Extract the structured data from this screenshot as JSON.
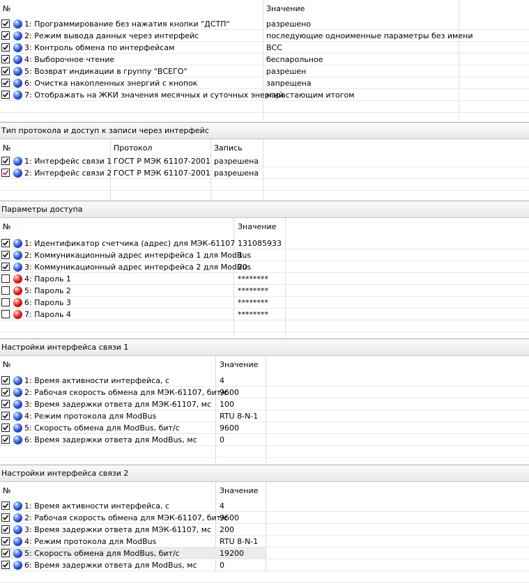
{
  "section1": {
    "header": {
      "num": "№",
      "value": "Значение"
    },
    "rows": [
      {
        "checked": true,
        "ball": "blue",
        "label": "1: Программирование без нажатия кнопки \"ДСТП\"",
        "value": "разрешено"
      },
      {
        "checked": true,
        "ball": "blue",
        "label": "2: Режим вывода данных через интерфейс",
        "value": "последующие одноименные параметры без имени"
      },
      {
        "checked": true,
        "ball": "blue",
        "label": "3: Контроль обмена по интерфейсам",
        "value": "ВСС"
      },
      {
        "checked": true,
        "ball": "blue",
        "label": "4: Выборочное чтение",
        "value": "беспарольное"
      },
      {
        "checked": true,
        "ball": "blue",
        "label": "5: Возврат индикации в  группу \"ВСЕГО\"",
        "value": "разрешен"
      },
      {
        "checked": true,
        "ball": "blue",
        "label": "6: Очистка накопленных энергий с кнопок",
        "value": "запрещена"
      },
      {
        "checked": true,
        "ball": "blue",
        "label": "7: Отображать на ЖКИ значения месячных и суточных энергий",
        "value": "нарастающим итогом"
      }
    ]
  },
  "section2": {
    "title": "Тип протокола и доступ к записи через интерфейс",
    "header": {
      "num": "№",
      "protocol": "Протокол",
      "write": "Запись"
    },
    "rows": [
      {
        "checked": true,
        "ball": "blue",
        "label": "1: Интерфейс связи 1",
        "protocol": "ГОСТ Р МЭК 61107-2001",
        "write": "разрешена"
      },
      {
        "checked": true,
        "check_red": true,
        "ball": "blue",
        "label": "2: Интерфейс связи 2",
        "protocol": "ГОСТ Р МЭК 61107-2001",
        "write": "разрешена"
      }
    ]
  },
  "section3": {
    "title": "Параметры доступа",
    "header": {
      "num": "№",
      "value": "Значение"
    },
    "rows": [
      {
        "checked": true,
        "ball": "blue",
        "label": "1: Идентификатор счетчика (адрес) для МЭК-61107",
        "value": "131085933"
      },
      {
        "checked": true,
        "ball": "blue",
        "label": "2: Коммуникационный адрес интерфейса 1 для ModBus",
        "value": "1"
      },
      {
        "checked": true,
        "ball": "blue",
        "label": "3: Коммуникационный адрес интерфейса 2 для ModBus",
        "value": "20"
      },
      {
        "checked": false,
        "ball": "red",
        "label": "4: Пароль 1",
        "value": "********"
      },
      {
        "checked": false,
        "ball": "red",
        "label": "5: Пароль 2",
        "value": "********"
      },
      {
        "checked": false,
        "ball": "red",
        "label": "6: Пароль 3",
        "value": "********"
      },
      {
        "checked": false,
        "ball": "red",
        "label": "7: Пароль 4",
        "value": "********"
      }
    ]
  },
  "section4": {
    "title": "Настройки интерфейса связи 1",
    "header": {
      "num": "№",
      "value": "Значение"
    },
    "rows": [
      {
        "checked": true,
        "ball": "blue",
        "label": "1: Время активности интерфейса, с",
        "value": "4"
      },
      {
        "checked": true,
        "ball": "blue",
        "label": "2: Рабочая скорость обмена для МЭК-61107, бит/с",
        "value": "9600"
      },
      {
        "checked": true,
        "ball": "blue",
        "label": "3: Время задержки ответа для МЭК-61107, мс",
        "value": "100"
      },
      {
        "checked": true,
        "ball": "blue",
        "label": "4: Режим протокола для ModBus",
        "value": "RTU 8-N-1"
      },
      {
        "checked": true,
        "ball": "blue",
        "label": "5: Скорость обмена для ModBus, бит/с",
        "value": "9600"
      },
      {
        "checked": true,
        "ball": "blue",
        "label": "6: Время задержки ответа для ModBus, мс",
        "value": "0"
      }
    ]
  },
  "section5": {
    "title": "Настройки интерфейса связи 2",
    "header": {
      "num": "№",
      "value": "Значение"
    },
    "rows": [
      {
        "checked": true,
        "ball": "blue",
        "label": "1: Время активности интерфейса, с",
        "value": "4"
      },
      {
        "checked": true,
        "ball": "blue",
        "label": "2: Рабочая скорость обмена для МЭК-61107, бит/с",
        "value": "9600"
      },
      {
        "checked": true,
        "ball": "blue",
        "label": "3: Время задержки ответа для МЭК-61107, мс",
        "value": "200"
      },
      {
        "checked": true,
        "ball": "blue",
        "label": "4: Режим протокола для ModBus",
        "value": "RTU 8-N-1"
      },
      {
        "checked": true,
        "ball": "blue",
        "label": "5: Скорость обмена для ModBus, бит/с",
        "value": "19200",
        "selected": true
      },
      {
        "checked": true,
        "ball": "blue",
        "label": "6: Время задержки ответа для ModBus, мс",
        "value": "0"
      }
    ]
  },
  "icons": {
    "checkbox": "checkbox-icon",
    "status_blue": "blue-ball-icon",
    "status_red": "red-ball-icon"
  },
  "colors": {
    "status_ok": "#2b4fd6",
    "status_off": "#e01414",
    "check_red": "#d02020"
  }
}
